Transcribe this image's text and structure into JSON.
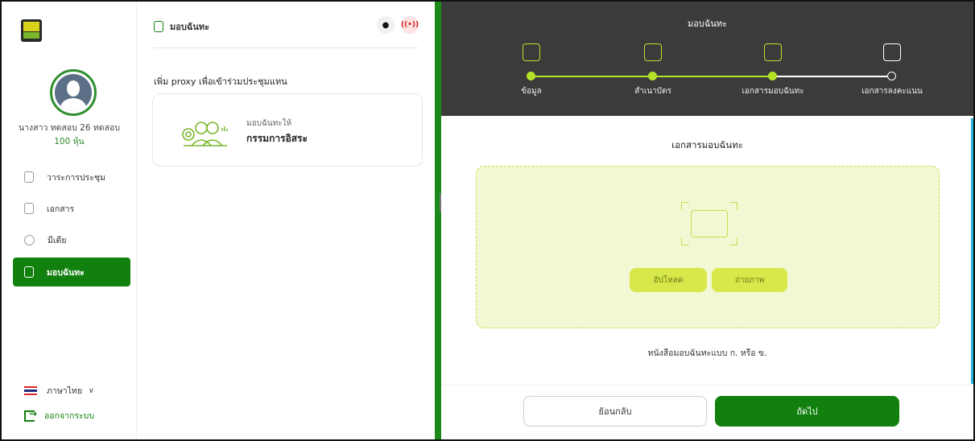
{
  "sidebar": {
    "user_name": "นางสาว ทดสอบ 26 ทดสอบ",
    "user_shares": "100 หุ้น",
    "items": [
      {
        "label": "วาระการประชุม"
      },
      {
        "label": "เอกสาร"
      },
      {
        "label": "มีเดีย"
      },
      {
        "label": "มอบฉันทะ"
      }
    ],
    "language": "ภาษาไทย",
    "logout": "ออกจากระบบ"
  },
  "middle": {
    "title": "มอบฉันทะ",
    "proxy_heading": "เพิ่ม proxy เพื่อเข้าร่วมประชุมแทน",
    "card": {
      "sub": "มอบฉันทะให้",
      "main": "กรรมการอิสระ"
    },
    "live_label": "LIVE"
  },
  "stepper": {
    "title": "มอบฉันทะ",
    "steps": [
      {
        "label": "ข้อมูล"
      },
      {
        "label": "สำเนาบัตร"
      },
      {
        "label": "เอกสารมอบฉันทะ"
      },
      {
        "label": "เอกสารลงคะแนน"
      }
    ]
  },
  "document": {
    "title": "เอกสารมอบฉันทะ",
    "upload_label": "อัปโหลด",
    "photo_label": "ถ่ายภาพ",
    "caption": "หนังสือมอบฉันทะแบบ ก. หรือ ข."
  },
  "footer": {
    "back_label": "ย้อนกลับ",
    "next_label": "ถัดไป"
  },
  "colors": {
    "primary_green": "#12800f",
    "accent_lime": "#b5e32a",
    "upload_bg": "#f3f8d4",
    "header_dark": "#3b3b3b"
  }
}
